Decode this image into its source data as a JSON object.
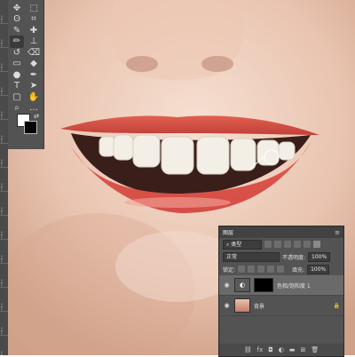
{
  "ruler": {
    "labels": [
      "ᵀᴮᴼ",
      "ᵀᴮᴼ",
      "ᵀᴮᴼ",
      "ᵀᴮᴼ",
      "ᵀᴮᴼ",
      "ᵀᴮᴼ",
      "ᵀᴮᴼ",
      "ᵀᴮᴼ",
      "ᵀᴮᴼ",
      "ᵀᴮᴼ",
      "ᵀᴮᴼ",
      "ᵀᴮᴼ",
      "ᵀᴮᴼ",
      "ᵀᴮᴼ",
      "ᵀᴮᴼ"
    ]
  },
  "toolbar": {
    "tools": [
      {
        "name": "move-icon",
        "glyph": "✥"
      },
      {
        "name": "marquee-icon",
        "glyph": "⬚"
      },
      {
        "name": "lasso-icon",
        "glyph": "ʘ"
      },
      {
        "name": "crop-icon",
        "glyph": "⌗"
      },
      {
        "name": "eyedropper-icon",
        "glyph": "✎"
      },
      {
        "name": "heal-icon",
        "glyph": "✚"
      },
      {
        "name": "brush-icon",
        "glyph": "✏"
      },
      {
        "name": "stamp-icon",
        "glyph": "⊥"
      },
      {
        "name": "history-brush-icon",
        "glyph": "↺"
      },
      {
        "name": "eraser-icon",
        "glyph": "⌫"
      },
      {
        "name": "gradient-icon",
        "glyph": "▭"
      },
      {
        "name": "blur-icon",
        "glyph": "◆"
      },
      {
        "name": "dodge-icon",
        "glyph": "●"
      },
      {
        "name": "pen-icon",
        "glyph": "✒"
      },
      {
        "name": "type-icon",
        "glyph": "T"
      },
      {
        "name": "path-select-icon",
        "glyph": "➤"
      },
      {
        "name": "shape-icon",
        "glyph": "▢"
      },
      {
        "name": "hand-icon",
        "glyph": "✋"
      },
      {
        "name": "zoom-icon",
        "glyph": "⌕"
      },
      {
        "name": "more-icon",
        "glyph": "…"
      }
    ],
    "colors": {
      "foreground": "#ffffff",
      "background": "#000000"
    }
  },
  "layers_panel": {
    "tab_title": "图层",
    "filter_label": "类型",
    "blend_mode": "正常",
    "opacity_label": "不透明度:",
    "opacity_value": "100%",
    "lock_label": "锁定:",
    "fill_label": "填充:",
    "fill_value": "100%",
    "layers": [
      {
        "name": "色相/饱和度 1",
        "selected": true
      },
      {
        "name": "背景",
        "selected": false
      }
    ],
    "bottom_icons": [
      "link-icon",
      "fx-icon",
      "mask-icon",
      "adjustment-icon",
      "folder-icon",
      "new-layer-icon",
      "trash-icon"
    ],
    "bottom_glyphs": [
      "⛓",
      "fx",
      "◘",
      "◐",
      "▬",
      "⊞",
      "🗑"
    ]
  }
}
